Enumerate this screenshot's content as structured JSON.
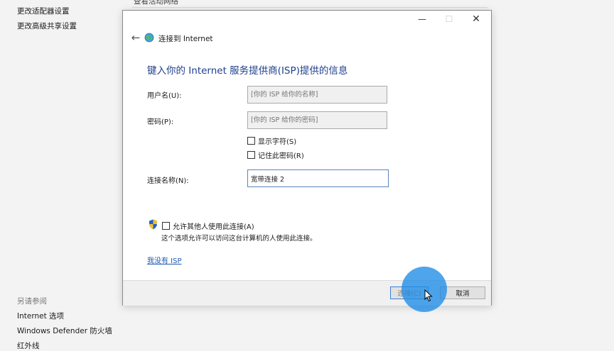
{
  "background": {
    "top_text": "查看活动网络",
    "side_links": [
      "更改适配器设置",
      "更改高级共享设置"
    ],
    "see_also_label": "另请参阅",
    "see_also_links": [
      "Internet 选项",
      "Windows Defender 防火墙",
      "红外线"
    ]
  },
  "dialog": {
    "window_buttons": {
      "minimize": "—",
      "maximize": "☐",
      "close": "✕"
    },
    "back_icon": "←",
    "nav_title": "连接到 Internet",
    "heading": "键入你的 Internet 服务提供商(ISP)提供的信息",
    "username": {
      "label": "用户名(U):",
      "placeholder": "[你的 ISP 给你的名称]",
      "value": ""
    },
    "password": {
      "label": "密码(P):",
      "placeholder": "[你的 ISP 给你的密码]",
      "value": ""
    },
    "show_chars": {
      "label": "显示字符(S)",
      "checked": false
    },
    "remember_password": {
      "label": "记住此密码(R)",
      "checked": false
    },
    "connection_name": {
      "label": "连接名称(N):",
      "value": "宽带连接 2"
    },
    "allow_others": {
      "label": "允许其他人使用此连接(A)",
      "checked": false
    },
    "allow_description": "这个选项允许可以访问这台计算机的人使用此连接。",
    "no_isp_link": "我没有 ISP",
    "buttons": {
      "connect": "连接(C)",
      "cancel": "取消"
    }
  },
  "colors": {
    "heading": "#1e3e8c",
    "link": "#1e5ab4",
    "click_highlight": "#1e8ce6"
  }
}
